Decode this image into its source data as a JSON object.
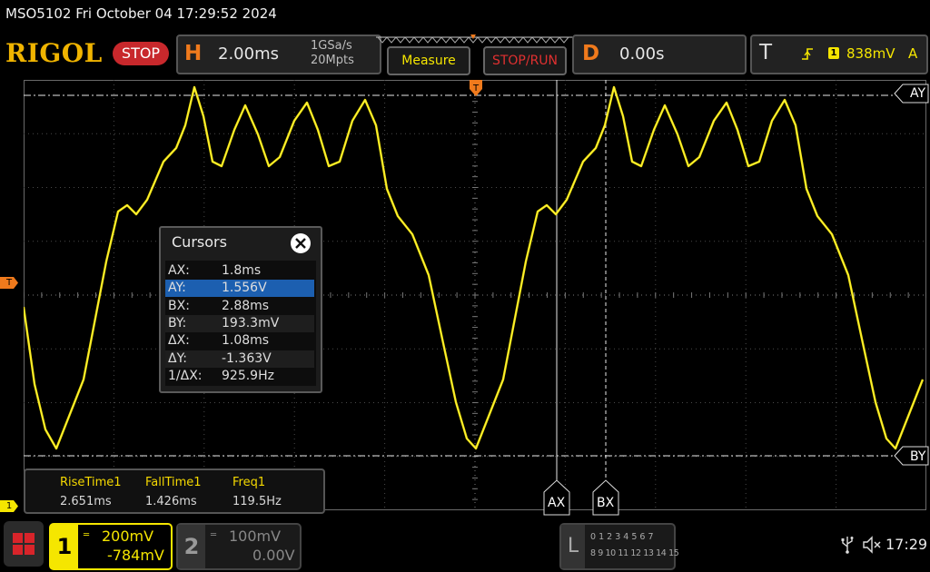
{
  "title_bar": {
    "text": "MSO5102  Fri October 04 17:29:52 2024"
  },
  "header": {
    "brand": "RIGOL",
    "run_state": "STOP",
    "horizontal": {
      "letter": "H",
      "timebase": "2.00ms",
      "sample_rate": "1GSa/s",
      "memory_depth": "20Mpts"
    },
    "measure_button": "Measure",
    "stoprun_button": "STOP/RUN",
    "delay": {
      "letter": "D",
      "value": "0.00s"
    },
    "trigger": {
      "letter": "T",
      "channel": "1",
      "level": "838mV",
      "mode": "A"
    }
  },
  "markers": {
    "ay": "AY",
    "by": "BY",
    "ax": "AX",
    "bx": "BX",
    "trig_left": "T",
    "ch1_left": "1"
  },
  "cursors_panel": {
    "title": "Cursors",
    "selected_row": "AY",
    "rows": [
      {
        "key": "AX:",
        "value": "1.8ms"
      },
      {
        "key": "AY:",
        "value": "1.556V"
      },
      {
        "key": "BX:",
        "value": "2.88ms"
      },
      {
        "key": "BY:",
        "value": "193.3mV"
      },
      {
        "key": "ΔX:",
        "value": "1.08ms"
      },
      {
        "key": "ΔY:",
        "value": "-1.363V"
      },
      {
        "key": "1/ΔX:",
        "value": "925.9Hz"
      }
    ]
  },
  "measurements": [
    {
      "label": "RiseTime1",
      "value": "2.651ms"
    },
    {
      "label": "FallTime1",
      "value": "1.426ms"
    },
    {
      "label": "Freq1",
      "value": "119.5Hz"
    }
  ],
  "footer": {
    "ch1": {
      "num": "1",
      "scale": "200mV",
      "offset": "-784mV",
      "color": "#f5e600"
    },
    "ch2": {
      "num": "2",
      "scale": "100mV",
      "offset": "0.00V",
      "color": "#808080"
    },
    "la": {
      "letter": "L",
      "row1": "0 1 2 3   4 5 6 7",
      "row2": "8 9 10 11 12 13 14 15"
    },
    "time": "17:29"
  },
  "colors": {
    "trace": "#f5e600",
    "accent": "#f07a1c",
    "stop": "#c8282c",
    "selected_row": "#1c5fb0"
  }
}
